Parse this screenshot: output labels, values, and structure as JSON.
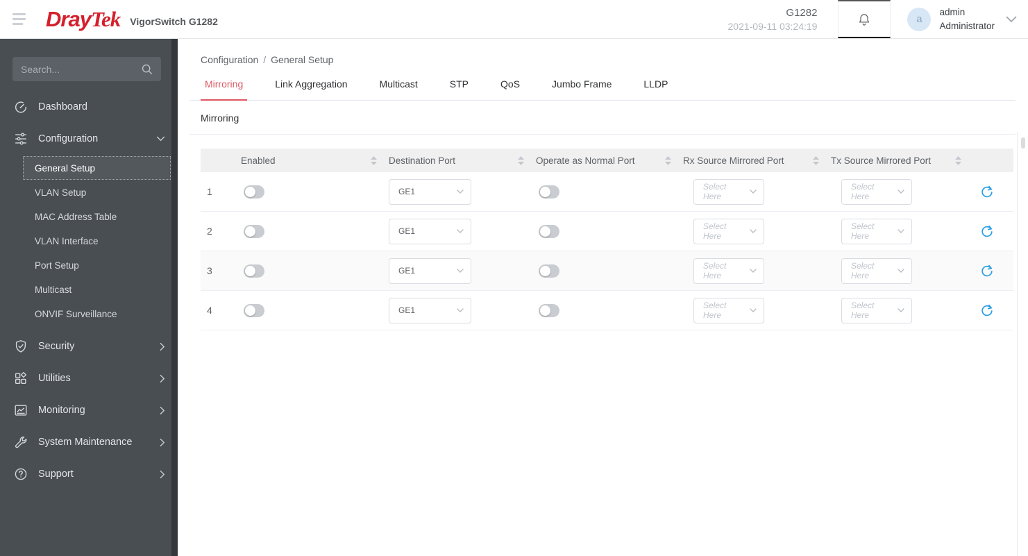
{
  "header": {
    "brand": {
      "dray": "Dray",
      "tek": "Tek"
    },
    "product_title": "VigorSwitch G1282",
    "model": "G1282",
    "datetime": "2021-09-11 03:24:19",
    "user": {
      "avatar_initial": "a",
      "name": "admin",
      "role": "Administrator"
    }
  },
  "sidebar": {
    "search_placeholder": "Search...",
    "items": {
      "dashboard": "Dashboard",
      "configuration": "Configuration",
      "security": "Security",
      "utilities": "Utilities",
      "monitoring": "Monitoring",
      "system_maintenance": "System Maintenance",
      "support": "Support"
    },
    "configuration_children": [
      "General Setup",
      "VLAN Setup",
      "MAC Address Table",
      "VLAN Interface",
      "Port Setup",
      "Multicast",
      "ONVIF Surveillance"
    ],
    "active_item": "General Setup"
  },
  "main": {
    "breadcrumb": {
      "parent": "Configuration",
      "separator": "/",
      "current": "General Setup"
    },
    "tabs": [
      "Mirroring",
      "Link Aggregation",
      "Multicast",
      "STP",
      "QoS",
      "Jumbo Frame",
      "LLDP"
    ],
    "active_tab": "Mirroring",
    "panel_title": "Mirroring",
    "table": {
      "columns": [
        "Enabled",
        "Destination Port",
        "Operate as Normal Port",
        "Rx Source Mirrored Port",
        "Tx Source Mirrored Port"
      ],
      "rows": [
        {
          "id": "1",
          "enabled": false,
          "destination_port": "GE1",
          "operate_as_normal_port": false,
          "rx_source_placeholder": "Select Here",
          "tx_source_placeholder": "Select Here"
        },
        {
          "id": "2",
          "enabled": false,
          "destination_port": "GE1",
          "operate_as_normal_port": false,
          "rx_source_placeholder": "Select Here",
          "tx_source_placeholder": "Select Here"
        },
        {
          "id": "3",
          "enabled": false,
          "destination_port": "GE1",
          "operate_as_normal_port": false,
          "rx_source_placeholder": "Select Here",
          "tx_source_placeholder": "Select Here"
        },
        {
          "id": "4",
          "enabled": false,
          "destination_port": "GE1",
          "operate_as_normal_port": false,
          "rx_source_placeholder": "Select Here",
          "tx_source_placeholder": "Select Here"
        }
      ]
    }
  },
  "colors": {
    "brand_red": "#d41f2c",
    "active_tab_red": "#dd5862",
    "refresh_blue": "#2b9fe3",
    "sidebar_bg": "#494e53",
    "table_header_bg": "#f0f0f0",
    "avatar_bg": "#d8e7f6"
  }
}
